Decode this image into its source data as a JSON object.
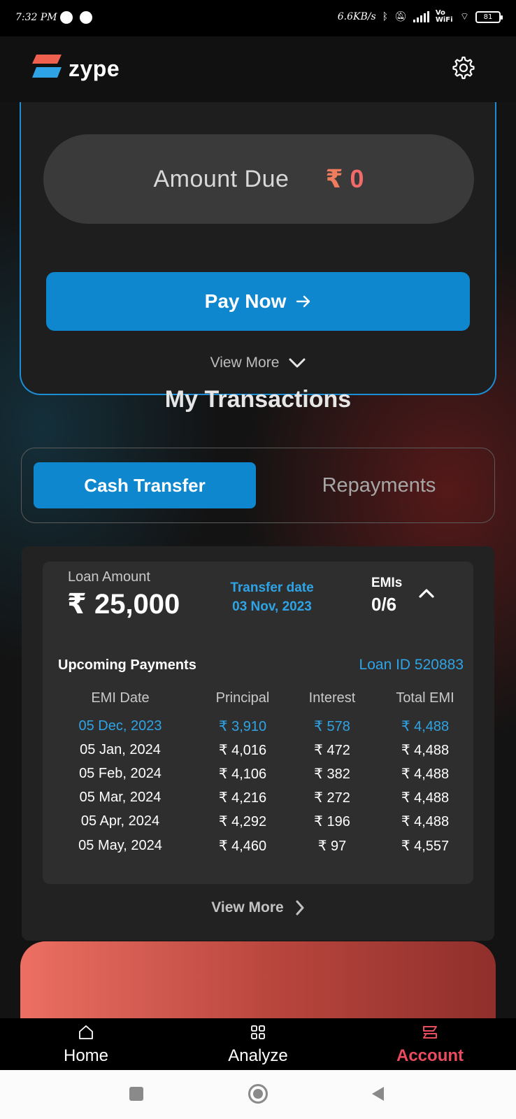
{
  "status_bar": {
    "time": "7:32 PM",
    "speed": "6.6KB/s",
    "network": "Vo WiFi",
    "battery": "81"
  },
  "header": {
    "brand": "zype",
    "settings_icon": "gear-icon"
  },
  "due_card": {
    "amount_label": "Amount Due",
    "currency": "₹",
    "amount_value": "0",
    "pay_button_label": "Pay Now",
    "view_more_label": "View More"
  },
  "transactions": {
    "title": "My Transactions",
    "tabs": [
      {
        "label": "Cash Transfer",
        "active": true
      },
      {
        "label": "Repayments",
        "active": false
      }
    ],
    "loan": {
      "amount_label": "Loan Amount",
      "amount": "₹ 25,000",
      "transfer_date_label": "Transfer date",
      "transfer_date": "03 Nov, 2023",
      "emis_label": "EMIs",
      "emis_value": "0/6",
      "upcoming_label": "Upcoming Payments",
      "loan_id": "Loan ID 520883",
      "columns": [
        "EMI Date",
        "Principal",
        "Interest",
        "Total EMI"
      ],
      "rows": [
        [
          "05 Dec, 2023",
          "₹ 3,910",
          "₹ 578",
          "₹ 4,488"
        ],
        [
          "05 Jan, 2024",
          "₹ 4,016",
          "₹ 472",
          "₹ 4,488"
        ],
        [
          "05 Feb, 2024",
          "₹ 4,106",
          "₹ 382",
          "₹ 4,488"
        ],
        [
          "05 Mar, 2024",
          "₹ 4,216",
          "₹ 272",
          "₹ 4,488"
        ],
        [
          "05 Apr, 2024",
          "₹ 4,292",
          "₹ 196",
          "₹ 4,488"
        ],
        [
          "05 May, 2024",
          "₹ 4,460",
          "₹ 97",
          "₹ 4,557"
        ]
      ]
    },
    "view_more_label": "View More"
  },
  "bottom_nav": {
    "items": [
      {
        "label": "Home",
        "icon": "home-icon",
        "active": false
      },
      {
        "label": "Analyze",
        "icon": "grid-icon",
        "active": false
      },
      {
        "label": "Account",
        "icon": "zype-logo-icon",
        "active": true
      }
    ]
  },
  "colors": {
    "accent_blue": "#0e87cf",
    "highlight_blue": "#2ea4e6",
    "active_red": "#ea4b5e",
    "amount_orange": "#f07c5e"
  }
}
